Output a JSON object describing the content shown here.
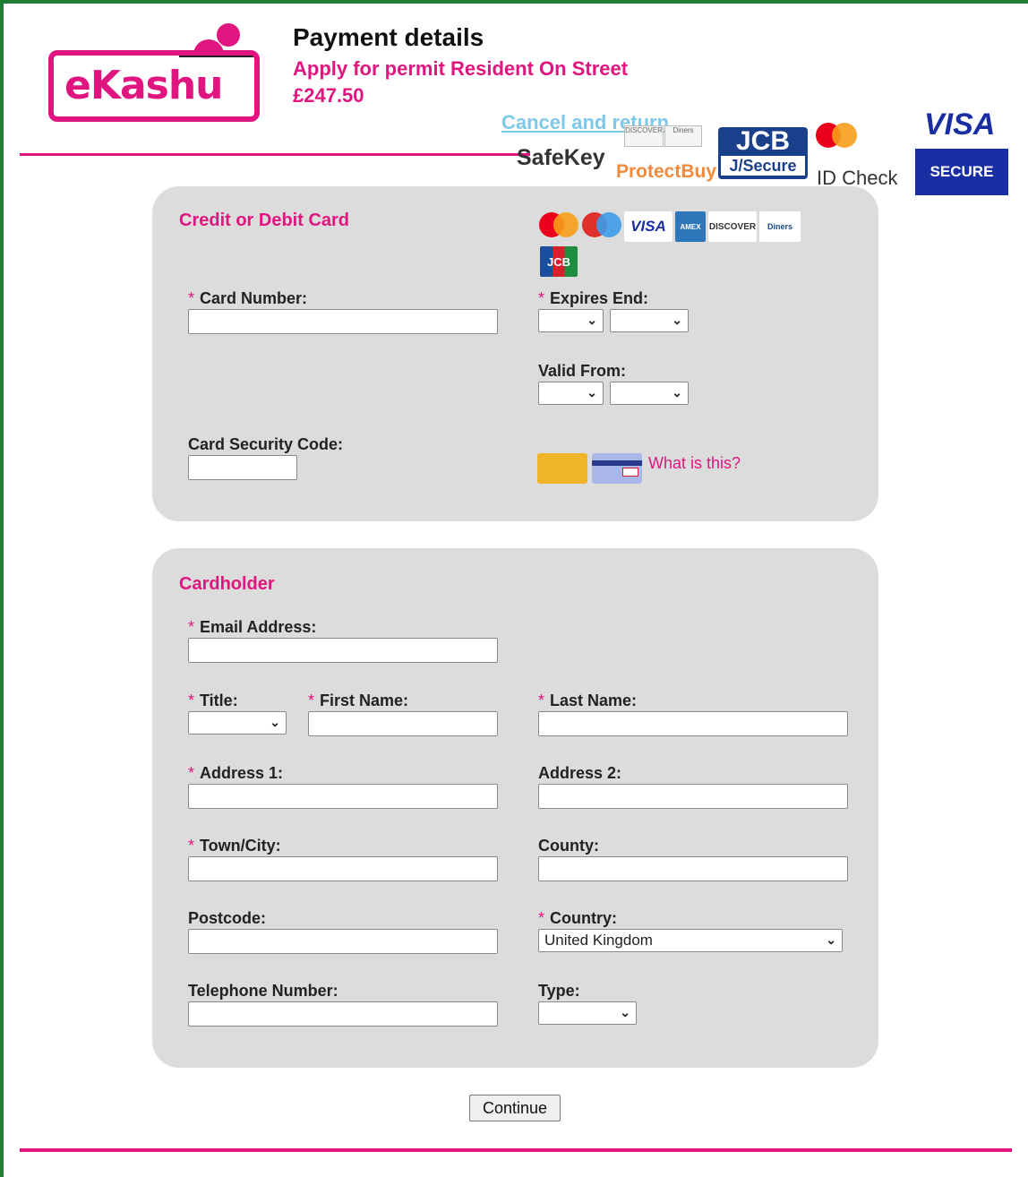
{
  "header": {
    "logo_text": "eKashu",
    "title": "Payment details",
    "subtitle": "Apply for permit Resident On Street",
    "amount": "£247.50",
    "cancel_link": "Cancel and return"
  },
  "security_logos": {
    "safekey": "SafeKey",
    "protectbuy": "ProtectBuy",
    "jcb": "JCB",
    "jsecure": "J/Secure",
    "idcheck": "ID Check",
    "visa": "VISA",
    "visa_secure": "SECURE"
  },
  "card_section": {
    "title": "Credit or Debit Card",
    "card_number_label": "Card Number:",
    "expires_label": "Expires End:",
    "valid_from_label": "Valid From:",
    "security_code_label": "Card Security Code:",
    "what_is_this": "What is this?",
    "card_types": [
      "mastercard",
      "maestro",
      "VISA",
      "AMEX",
      "DISCOVER",
      "Diners Club",
      "JCB"
    ]
  },
  "cardholder_section": {
    "title": "Cardholder",
    "email_label": "Email Address:",
    "title_label": "Title:",
    "first_name_label": "First Name:",
    "last_name_label": "Last Name:",
    "address1_label": "Address 1:",
    "address2_label": "Address 2:",
    "town_label": "Town/City:",
    "county_label": "County:",
    "postcode_label": "Postcode:",
    "country_label": "Country:",
    "country_value": "United Kingdom",
    "telephone_label": "Telephone Number:",
    "type_label": "Type:"
  },
  "actions": {
    "continue": "Continue"
  },
  "colors": {
    "brand": "#e0157f",
    "panel": "#dcdcdc",
    "frame": "#1e7e34"
  }
}
